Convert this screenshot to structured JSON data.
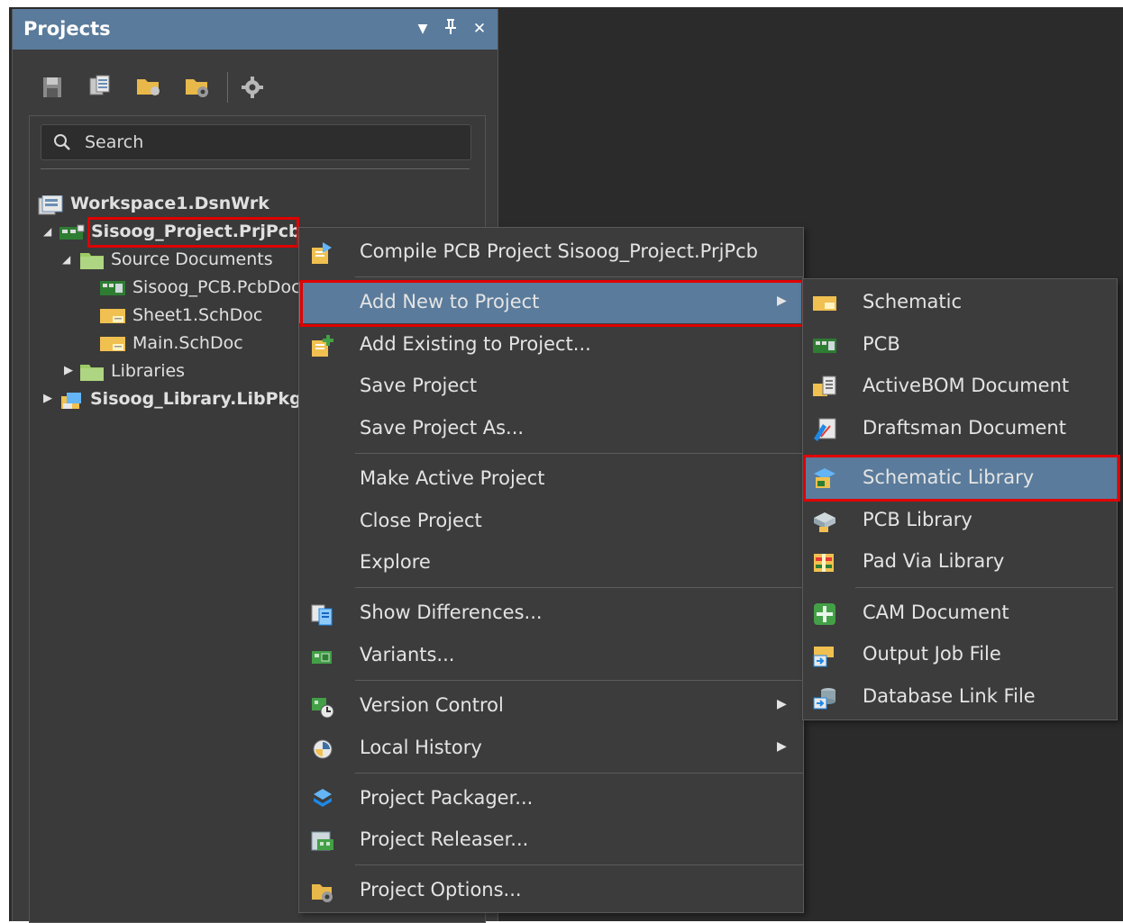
{
  "panel": {
    "title": "Projects",
    "controls": {
      "dropdown": "▼",
      "pin": "ᚙ",
      "close": "✕"
    },
    "toolbar": [
      "save-icon",
      "copy-icon",
      "folder-open-icon",
      "folder-settings-icon",
      "gear-icon"
    ],
    "search_placeholder": "Search"
  },
  "tree": {
    "workspace": "Workspace1.DsnWrk",
    "project": "Sisoog_Project.PrjPcb",
    "source_documents": "Source Documents",
    "docs": [
      "Sisoog_PCB.PcbDoc",
      "Sheet1.SchDoc",
      "Main.SchDoc"
    ],
    "libraries": "Libraries",
    "library_pkg": "Sisoog_Library.LibPkg"
  },
  "menu": {
    "items": [
      {
        "label": "Compile PCB Project Sisoog_Project.PrjPcb",
        "icon": "compile-icon"
      },
      {
        "label": "Add New to Project",
        "submenu": true
      },
      {
        "label": "Add Existing to Project...",
        "icon": "add-existing-icon"
      },
      {
        "label": "Save Project"
      },
      {
        "label": "Save Project As..."
      },
      {
        "label": "Make Active Project"
      },
      {
        "label": "Close Project"
      },
      {
        "label": "Explore"
      },
      {
        "label": "Show Differences...",
        "icon": "differences-icon"
      },
      {
        "label": "Variants...",
        "icon": "variants-icon"
      },
      {
        "label": "Version Control",
        "icon": "version-control-icon",
        "submenu": true
      },
      {
        "label": "Local History",
        "icon": "history-icon",
        "submenu": true
      },
      {
        "label": "Project Packager...",
        "icon": "packager-icon"
      },
      {
        "label": "Project Releaser...",
        "icon": "releaser-icon"
      },
      {
        "label": "Project Options...",
        "icon": "options-icon"
      }
    ],
    "submenu_arrow": "▶"
  },
  "submenu": {
    "items": [
      {
        "label": "Schematic",
        "icon": "schematic-icon"
      },
      {
        "label": "PCB",
        "icon": "pcb-icon"
      },
      {
        "label": "ActiveBOM Document",
        "icon": "bom-icon"
      },
      {
        "label": "Draftsman Document",
        "icon": "draftsman-icon"
      },
      {
        "label": "Schematic Library",
        "icon": "schematic-library-icon"
      },
      {
        "label": "PCB Library",
        "icon": "pcb-library-icon"
      },
      {
        "label": "Pad Via Library",
        "icon": "pad-via-library-icon"
      },
      {
        "label": "CAM Document",
        "icon": "cam-icon"
      },
      {
        "label": "Output Job File",
        "icon": "output-job-icon"
      },
      {
        "label": "Database Link File",
        "icon": "database-link-icon"
      }
    ]
  },
  "colors": {
    "highlight": "#5a7b9b",
    "annotation": "#e00000",
    "panel_bg": "#3c3c3c"
  }
}
